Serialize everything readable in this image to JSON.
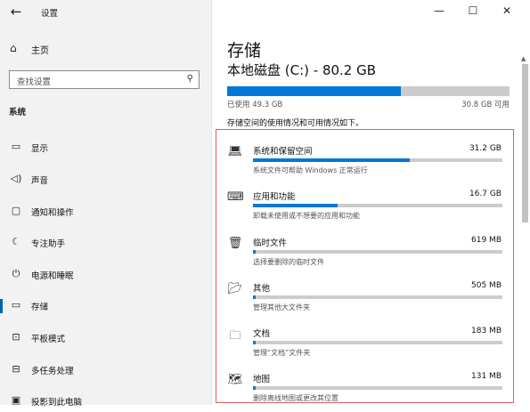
{
  "app": {
    "title": "设置"
  },
  "sidebar": {
    "home_label": "主页",
    "search_placeholder": "查找设置",
    "section": "系统",
    "items": [
      {
        "label": "显示",
        "icon": "display-icon"
      },
      {
        "label": "声音",
        "icon": "speaker-icon"
      },
      {
        "label": "通知和操作",
        "icon": "notification-icon"
      },
      {
        "label": "专注助手",
        "icon": "moon-icon"
      },
      {
        "label": "电源和睡眠",
        "icon": "power-icon"
      },
      {
        "label": "存储",
        "icon": "storage-icon",
        "active": true
      },
      {
        "label": "平板模式",
        "icon": "tablet-icon"
      },
      {
        "label": "多任务处理",
        "icon": "multitask-icon"
      },
      {
        "label": "投影到此电脑",
        "icon": "project-icon"
      }
    ]
  },
  "main": {
    "title": "存储",
    "disk_title": "本地磁盘 (C:) - 80.2 GB",
    "used_label": "已使用 49.3 GB",
    "free_label": "30.8 GB 可用",
    "used_fraction": 0.615,
    "usage_desc": "存储空间的使用情况和可用情况如下。",
    "categories": [
      {
        "name": "系统和保留空间",
        "size": "31.2 GB",
        "desc": "系统文件可帮助 Windows 正常运行",
        "fraction": 0.63,
        "icon": "laptop-icon"
      },
      {
        "name": "应用和功能",
        "size": "16.7 GB",
        "desc": "卸载未使用或不想要的应用和功能",
        "fraction": 0.34,
        "icon": "keyboard-icon"
      },
      {
        "name": "临时文件",
        "size": "619 MB",
        "desc": "选择要删除的临时文件",
        "fraction": 0.012,
        "icon": "trash-icon"
      },
      {
        "name": "其他",
        "size": "505 MB",
        "desc": "管理其他大文件夹",
        "fraction": 0.01,
        "icon": "folder-open-icon"
      },
      {
        "name": "文档",
        "size": "183 MB",
        "desc": "管理“文档”文件夹",
        "fraction": 0.004,
        "icon": "documents-folder-icon"
      },
      {
        "name": "地图",
        "size": "131 MB",
        "desc": "删除离线地图或更改其位置",
        "fraction": 0.003,
        "icon": "map-icon"
      }
    ]
  },
  "colors": {
    "accent": "#0078d7",
    "highlight_box": "#e06060",
    "sidebar_bg": "#f2f2f2"
  }
}
